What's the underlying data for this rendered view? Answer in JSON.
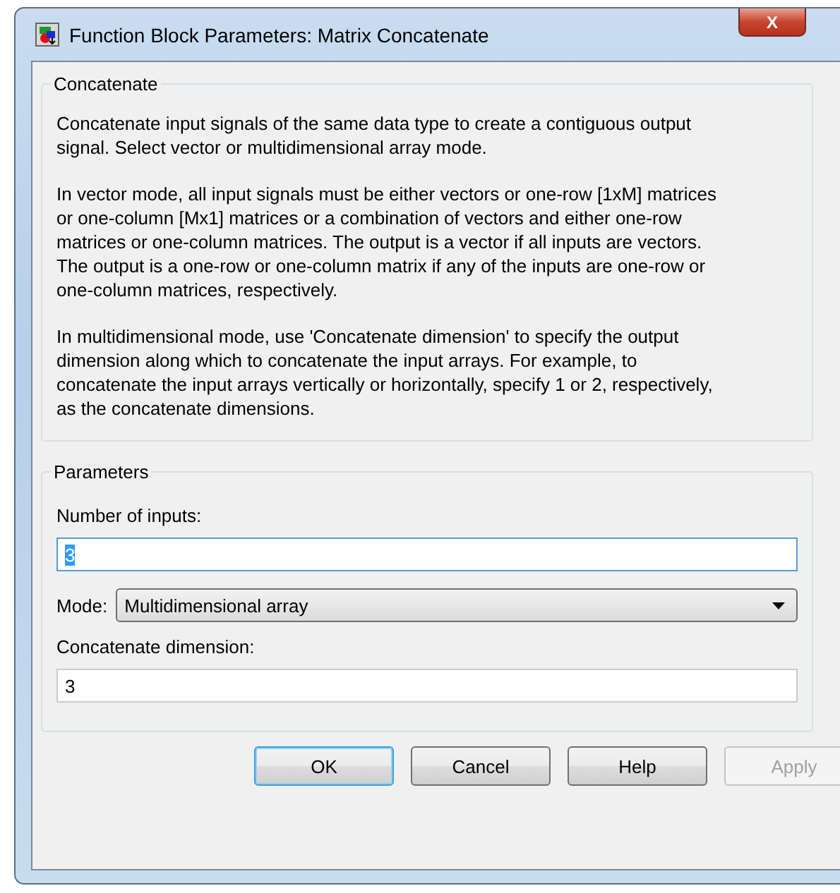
{
  "window": {
    "title": "Function Block Parameters: Matrix Concatenate",
    "close_label": "X"
  },
  "description": {
    "title": "Concatenate",
    "paragraphs": [
      "Concatenate input signals of the same data type to create a contiguous output\nsignal. Select vector or multidimensional array mode.",
      "In vector mode, all input signals must be either vectors or one-row [1xM] matrices\nor one-column [Mx1] matrices or a combination of vectors and either one-row\nmatrices or one-column matrices. The output is a vector if all inputs are vectors.\nThe output is a one-row or one-column matrix if any of the inputs are one-row or\none-column matrices, respectively.",
      "In multidimensional mode, use 'Concatenate dimension' to specify the output\ndimension along which to concatenate the input arrays. For example, to\nconcatenate the input arrays vertically or horizontally, specify 1 or 2, respectively,\nas the concatenate dimensions."
    ]
  },
  "parameters": {
    "title": "Parameters",
    "fields": [
      {
        "kind": "text",
        "label": "Number of inputs:",
        "value": "3",
        "focused": true,
        "value_selected": true
      },
      {
        "kind": "dropdown",
        "label": "Mode:",
        "value": "Multidimensional array"
      },
      {
        "kind": "text",
        "label": "Concatenate dimension:",
        "value": "3",
        "focused": false,
        "value_selected": false
      }
    ]
  },
  "buttons": [
    {
      "label": "OK",
      "default": true,
      "disabled": false
    },
    {
      "label": "Cancel",
      "default": false,
      "disabled": false
    },
    {
      "label": "Help",
      "default": false,
      "disabled": false
    },
    {
      "label": "Apply",
      "default": false,
      "disabled": true
    }
  ]
}
